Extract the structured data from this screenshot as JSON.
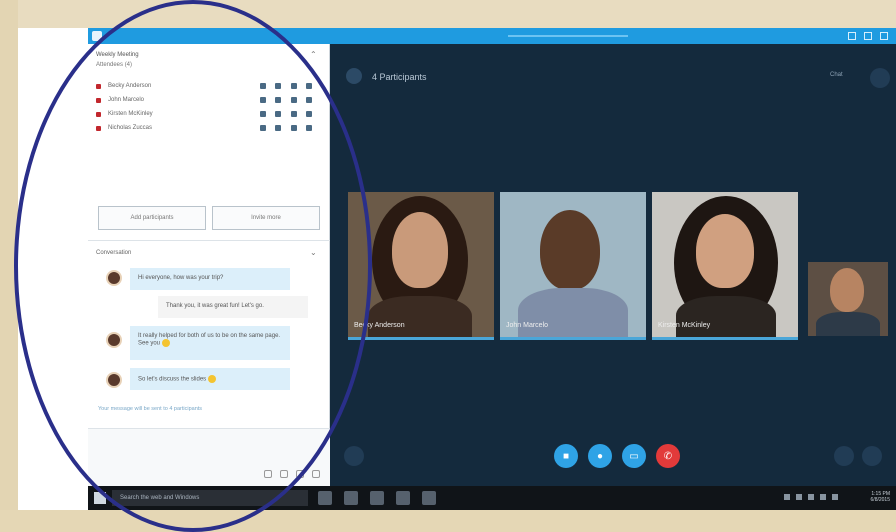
{
  "left_panel": {
    "meeting_title": "Weekly Meeting",
    "meeting_subtitle": "Attendees (4)",
    "participants": [
      {
        "name": "Becky Anderson"
      },
      {
        "name": "John Marcelo"
      },
      {
        "name": "Kirsten McKinley"
      },
      {
        "name": "Nicholas Zuccas"
      }
    ],
    "buttons": {
      "add": "Add participants",
      "invite": "Invite more"
    },
    "conversation_title": "Conversation",
    "messages": [
      {
        "text": "Hi everyone, how was your trip?",
        "own": false
      },
      {
        "text": "Thank you, it was great fun! Let's go.",
        "own": true
      },
      {
        "text": "It really helped for both of us to be on the same page. See you",
        "own": false
      },
      {
        "text": "So  let's discuss the slides",
        "own": false
      }
    ],
    "note": "Your message will be sent to 4 participants"
  },
  "video": {
    "title": "4 Participants",
    "top_right_text": "Chat",
    "tiles": [
      {
        "label": "Becky Anderson"
      },
      {
        "label": "John Marcelo"
      },
      {
        "label": "Kirsten McKinley"
      },
      {
        "label": ""
      }
    ]
  },
  "taskbar": {
    "search_placeholder": "Search the web and Windows",
    "time": "1:15 PM",
    "date": "6/8/2015"
  },
  "colors": {
    "accent": "#1f9be0",
    "video_bg": "#142a3d",
    "end_call": "#e23a3a",
    "annotation_ellipse": "#2a2f8a"
  }
}
